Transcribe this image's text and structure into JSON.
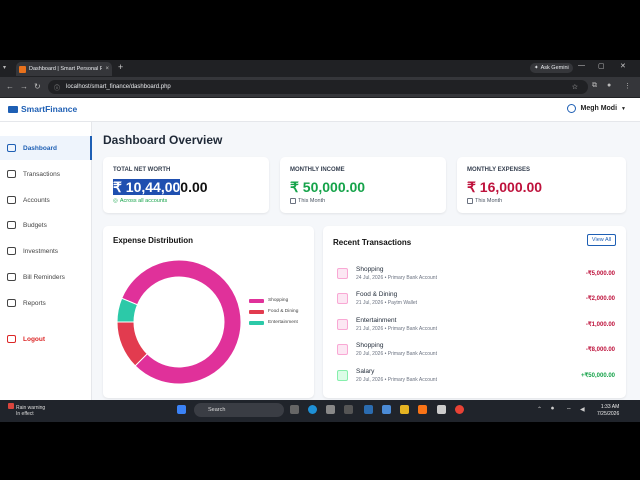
{
  "browser": {
    "tab_title": "Dashboard | Smart Personal Fi",
    "new_tab": "+",
    "ask_gemini": "Ask Gemini",
    "url": "localhost/smart_finance/dashboard.php"
  },
  "app": {
    "brand": "SmartFinance",
    "user_name": "Megh Modi"
  },
  "sidebar": {
    "items": [
      {
        "label": "Dashboard",
        "icon": "gauge-icon"
      },
      {
        "label": "Transactions",
        "icon": "exchange-icon"
      },
      {
        "label": "Accounts",
        "icon": "bank-icon"
      },
      {
        "label": "Budgets",
        "icon": "wallet-icon"
      },
      {
        "label": "Investments",
        "icon": "chart-line-icon"
      },
      {
        "label": "Bill Reminders",
        "icon": "receipt-icon"
      },
      {
        "label": "Reports",
        "icon": "pie-chart-icon"
      }
    ],
    "logout": "Logout"
  },
  "main": {
    "title": "Dashboard Overview",
    "stats": {
      "net_worth": {
        "label": "TOTAL NET WORTH",
        "value_selected": "₹ 10,44,00",
        "value_rest": "0.00",
        "sub": "Across all accounts"
      },
      "income": {
        "label": "MONTHLY INCOME",
        "value": "₹ 50,000.00",
        "sub": "This Month"
      },
      "expenses": {
        "label": "MONTHLY EXPENSES",
        "value": "₹ 16,000.00",
        "sub": "This Month"
      }
    },
    "expense_title": "Expense Distribution",
    "recent_title": "Recent Transactions",
    "view_all": "View All",
    "transactions": [
      {
        "name": "Shopping",
        "meta": "24 Jul, 2026 • Primary Bank Account",
        "amount": "-₹5,000.00",
        "type": "debit"
      },
      {
        "name": "Food & Dining",
        "meta": "21 Jul, 2026 • Paytm Wallet",
        "amount": "-₹2,000.00",
        "type": "debit"
      },
      {
        "name": "Entertainment",
        "meta": "21 Jul, 2026 • Primary Bank Account",
        "amount": "-₹1,000.00",
        "type": "debit"
      },
      {
        "name": "Shopping",
        "meta": "20 Jul, 2026 • Primary Bank Account",
        "amount": "-₹8,000.00",
        "type": "debit"
      },
      {
        "name": "Salary",
        "meta": "20 Jul, 2026 • Primary Bank Account",
        "amount": "+₹50,000.00",
        "type": "credit"
      }
    ]
  },
  "chart_data": {
    "type": "pie",
    "variant": "doughnut",
    "categories": [
      "Shopping",
      "Food & Dining",
      "Entertainment"
    ],
    "values": [
      13000,
      2000,
      1000
    ],
    "colors": [
      "#e0319a",
      "#e23b4f",
      "#2cc9a8"
    ],
    "legend_position": "right"
  },
  "taskbar": {
    "weather_line1": "Rain warning",
    "weather_line2": "In effect",
    "search": "Search",
    "time": "1:33 AM",
    "date": "7/25/2026"
  }
}
